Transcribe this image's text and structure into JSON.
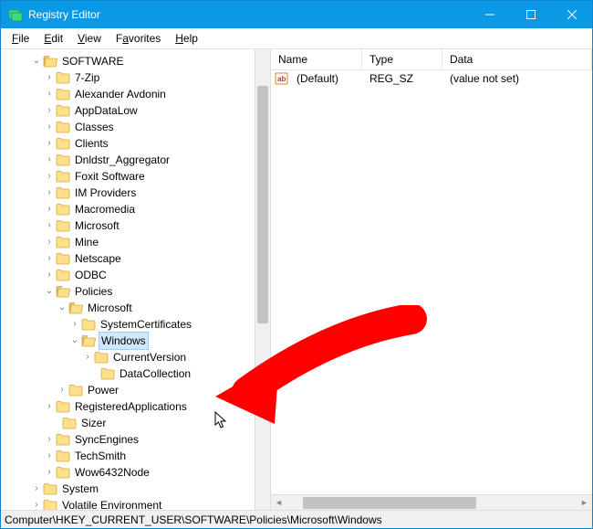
{
  "window": {
    "title": "Registry Editor"
  },
  "menu": {
    "file": "File",
    "edit": "Edit",
    "view": "View",
    "favorites": "Favorites",
    "help": "Help"
  },
  "tree": {
    "root": "SOFTWARE",
    "items": [
      "7-Zip",
      "Alexander Avdonin",
      "AppDataLow",
      "Classes",
      "Clients",
      "Dnldstr_Aggregator",
      "Foxit Software",
      "IM Providers",
      "Macromedia",
      "Microsoft",
      "Mine",
      "Netscape",
      "ODBC"
    ],
    "policies": "Policies",
    "ms": "Microsoft",
    "ms_children": [
      "SystemCertificates"
    ],
    "windows": "Windows",
    "win_children": [
      "CurrentVersion",
      "DataCollection"
    ],
    "power": "Power",
    "after": [
      "RegisteredApplications",
      "Sizer",
      "SyncEngines",
      "TechSmith",
      "Wow6432Node"
    ],
    "tail": [
      "System",
      "Volatile Environment"
    ]
  },
  "list": {
    "cols": {
      "name": "Name",
      "type": "Type",
      "data": "Data"
    },
    "row": {
      "name": "(Default)",
      "type": "REG_SZ",
      "data": "(value not set)"
    }
  },
  "status": "Computer\\HKEY_CURRENT_USER\\SOFTWARE\\Policies\\Microsoft\\Windows"
}
